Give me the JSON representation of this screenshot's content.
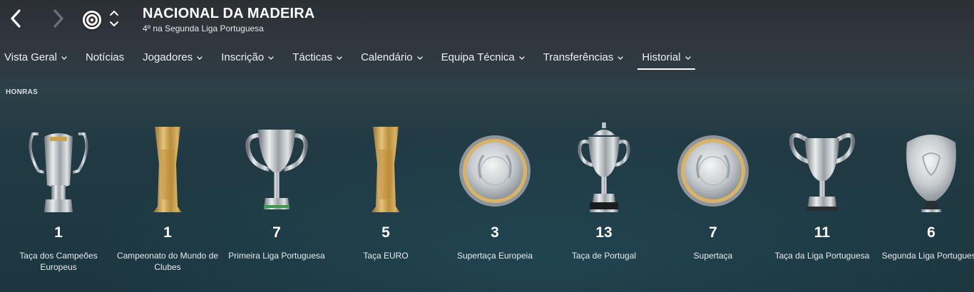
{
  "header": {
    "club_name": "NACIONAL DA MADEIRA",
    "club_subtitle": "4º na Segunda Liga Portuguesa",
    "icons": [
      "back-arrow-icon",
      "forward-arrow-icon",
      "club-crest-icon",
      "club-switch-chevrons-icon"
    ]
  },
  "tabs": [
    {
      "label": "Vista Geral",
      "has_menu": true
    },
    {
      "label": "Notícias",
      "has_menu": false
    },
    {
      "label": "Jogadores",
      "has_menu": true
    },
    {
      "label": "Inscrição",
      "has_menu": true
    },
    {
      "label": "Tácticas",
      "has_menu": true
    },
    {
      "label": "Calendário",
      "has_menu": true
    },
    {
      "label": "Equipa Técnica",
      "has_menu": true
    },
    {
      "label": "Transferências",
      "has_menu": true
    },
    {
      "label": "Historial",
      "has_menu": true,
      "active": true
    }
  ],
  "section": {
    "label": "HONRAS"
  },
  "honours": [
    {
      "count": "1",
      "name": "Taça dos Campeões Europeus",
      "trophy": "big-ears-trophy-icon"
    },
    {
      "count": "1",
      "name": "Campeonato do Mundo de Clubes",
      "trophy": "gold-cup-trophy-icon"
    },
    {
      "count": "7",
      "name": "Primeira Liga Portuguesa",
      "trophy": "silver-handled-cup-icon"
    },
    {
      "count": "5",
      "name": "Taça EURO",
      "trophy": "gold-cup-trophy-icon"
    },
    {
      "count": "3",
      "name": "Supertaça Europeia",
      "trophy": "plate-trophy-icon"
    },
    {
      "count": "13",
      "name": "Taça de Portugal",
      "trophy": "lidded-cup-trophy-icon"
    },
    {
      "count": "7",
      "name": "Supertaça",
      "trophy": "plate-trophy-icon"
    },
    {
      "count": "11",
      "name": "Taça da Liga Portuguesa",
      "trophy": "handled-cup-trophy-icon"
    },
    {
      "count": "6",
      "name": "Segunda Liga Portuguesa",
      "trophy": "shield-trophy-icon"
    }
  ],
  "colors": {
    "silver": "#c8cdd1",
    "gold": "#c9a24a",
    "accent_white": "#ffffff"
  }
}
